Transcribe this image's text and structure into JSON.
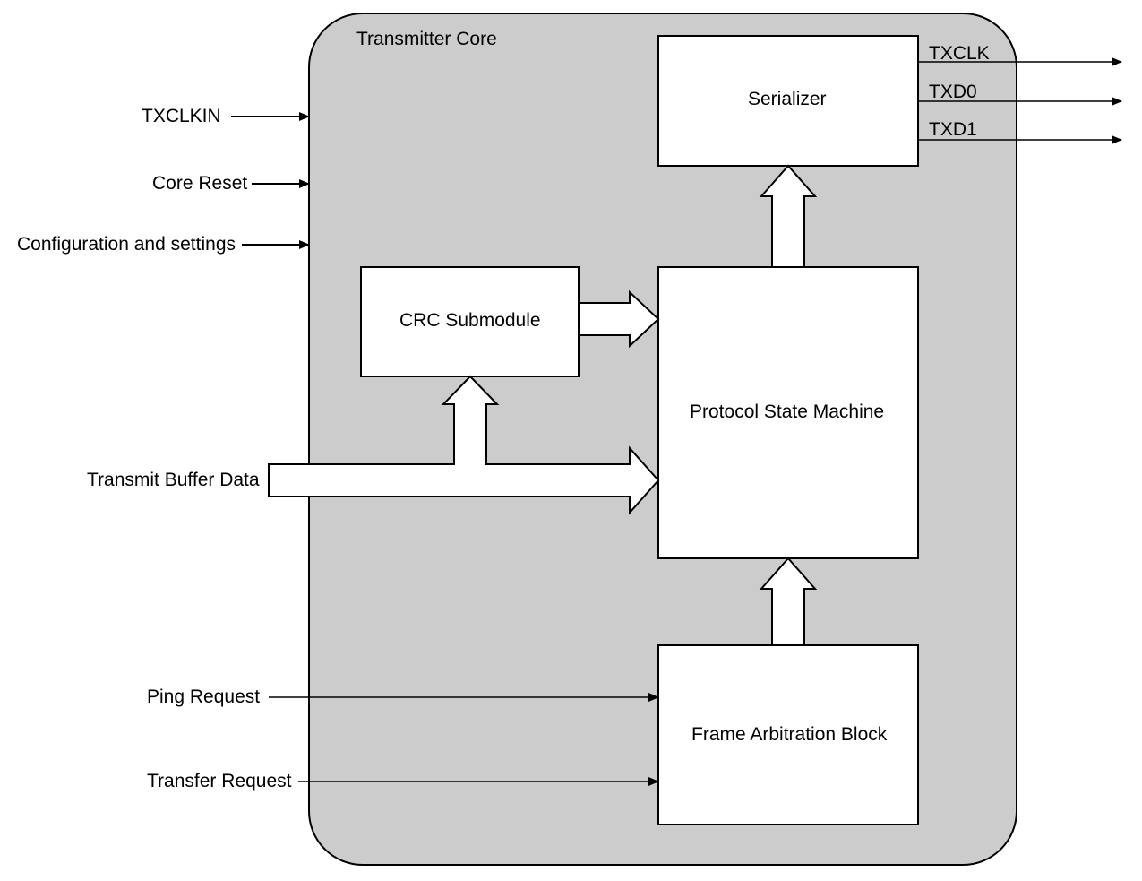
{
  "diagram": {
    "title": "Transmitter Core",
    "blocks": {
      "serializer": "Serializer",
      "crc": "CRC Submodule",
      "psm": "Protocol State Machine",
      "fab": "Frame Arbitration Block"
    },
    "inputs": {
      "txclkin": "TXCLKIN",
      "core_reset": "Core Reset",
      "config": "Configuration and settings",
      "txbuf": "Transmit Buffer Data",
      "ping": "Ping Request",
      "transfer": "Transfer Request"
    },
    "outputs": {
      "txclk": "TXCLK",
      "txd0": "TXD0",
      "txd1": "TXD1"
    }
  }
}
